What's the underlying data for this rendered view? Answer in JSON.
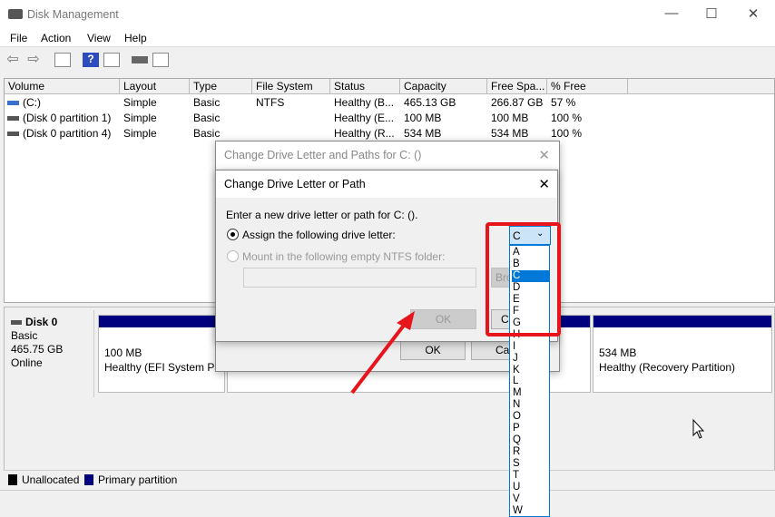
{
  "window": {
    "title": "Disk Management",
    "minimize": "—",
    "maximize": "☐",
    "close": "✕"
  },
  "menu": [
    "File",
    "Action",
    "View",
    "Help"
  ],
  "toolbar": {
    "back": "⇦",
    "forward": "⇨",
    "help": "?"
  },
  "table": {
    "headers": [
      "Volume",
      "Layout",
      "Type",
      "File System",
      "Status",
      "Capacity",
      "Free Spa...",
      "% Free"
    ],
    "rows": [
      [
        "(C:)",
        "Simple",
        "Basic",
        "NTFS",
        "Healthy (B...",
        "465.13 GB",
        "266.87 GB",
        "57 %"
      ],
      [
        "(Disk 0 partition 1)",
        "Simple",
        "Basic",
        "",
        "Healthy (E...",
        "100 MB",
        "100 MB",
        "100 %"
      ],
      [
        "(Disk 0 partition 4)",
        "Simple",
        "Basic",
        "",
        "Healthy (R...",
        "534 MB",
        "534 MB",
        "100 %"
      ]
    ]
  },
  "disk": {
    "name": "Disk 0",
    "type": "Basic",
    "size": "465.75 GB",
    "state": "Online",
    "partitions": [
      {
        "size": "100 MB",
        "status": "Healthy (EFI System Partition)"
      },
      {
        "size": "",
        "status": ""
      },
      {
        "size": "534 MB",
        "status": "Healthy (Recovery Partition)"
      }
    ]
  },
  "legend": {
    "unallocated": "Unallocated",
    "primary": "Primary partition",
    "colors": {
      "unallocated": "#000000",
      "primary": "#00007f"
    }
  },
  "back_dialog": {
    "title": "Change Drive Letter and Paths for C: ()",
    "ok": "OK",
    "cancel": "Ca"
  },
  "dialog": {
    "title": "Change Drive Letter or Path",
    "prompt": "Enter a new drive letter or path for C: ().",
    "assign_label": "Assign the following drive letter:",
    "mount_label": "Mount in the following empty NTFS folder:",
    "browse": "Bro",
    "ok": "OK",
    "cancel": "Ca",
    "selected_letter": "C",
    "letters": [
      "A",
      "B",
      "C",
      "D",
      "E",
      "F",
      "G",
      "H",
      "I",
      "J",
      "K",
      "L",
      "M",
      "N",
      "O",
      "P",
      "Q",
      "R",
      "S",
      "T",
      "U",
      "V",
      "W"
    ]
  },
  "annotation_color": "#e8141b"
}
